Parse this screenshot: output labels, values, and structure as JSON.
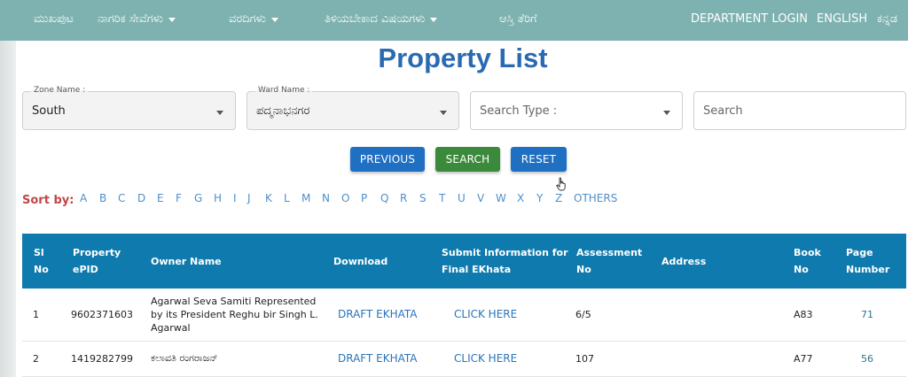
{
  "nav": {
    "home": "ಮುಖಪುಟ",
    "citizen_services": "ನಾಗರಿಕ ಸೇವೆಗಳು",
    "reports": "ವರದಿಗಳು",
    "to_know": "ತಿಳಿಯಬೇಕಾದ ವಿಷಯಗಳು",
    "property_tax": "ಆಸ್ತಿ ತೆರಿಗೆ",
    "department_login": "DEPARTMENT LOGIN",
    "english": "ENGLISH",
    "kannada": "ಕನ್ನಡ"
  },
  "page_title": "Property List",
  "filters": {
    "zone": {
      "label": "Zone Name :",
      "value": "South"
    },
    "ward": {
      "label": "Ward Name :",
      "value": "ಪದ್ಮನಾಭನಗರ"
    },
    "search_type": {
      "placeholder": "Search Type :"
    },
    "search": {
      "placeholder": "Search"
    }
  },
  "buttons": {
    "previous": "PREVIOUS",
    "search": "SEARCH",
    "reset": "RESET"
  },
  "sort": {
    "label": "Sort by:",
    "letters": [
      "A",
      "B",
      "C",
      "D",
      "E",
      "F",
      "G",
      "H",
      "I",
      "J",
      "K",
      "L",
      "M",
      "N",
      "O",
      "P",
      "Q",
      "R",
      "S",
      "T",
      "U",
      "V",
      "W",
      "X",
      "Y",
      "Z",
      "OTHERS"
    ]
  },
  "table": {
    "headers": {
      "sl_no_1": "Sl",
      "sl_no_2": "No",
      "epid_1": "Property",
      "epid_2": "ePID",
      "owner": "Owner Name",
      "download": "Download",
      "submit_1": "Submit Information for",
      "submit_2": "Final EKhata",
      "assessment_1": "Assessment",
      "assessment_2": "No",
      "address": "Address",
      "book_1": "Book",
      "book_2": "No",
      "page_1": "Page",
      "page_2": "Number"
    },
    "rows": [
      {
        "sl": "1",
        "epid": "9602371603",
        "owner_line1": "Agarwal Seva Samiti Represented",
        "owner_line2": "by its President Reghu bir Singh L.",
        "owner_line3": "Agarwal",
        "download": "DRAFT EKHATA",
        "submit": "CLICK HERE",
        "assessment": "6/5",
        "address": "",
        "book": "A83",
        "page": "71"
      },
      {
        "sl": "2",
        "epid": "1419282799",
        "owner_line1": "ಕಲಾವತಿ ರಂಗರಾಜನ್",
        "download": "DRAFT EKHATA",
        "submit": "CLICK HERE",
        "assessment": "107",
        "address": "",
        "book": "A77",
        "page": "56"
      }
    ]
  }
}
